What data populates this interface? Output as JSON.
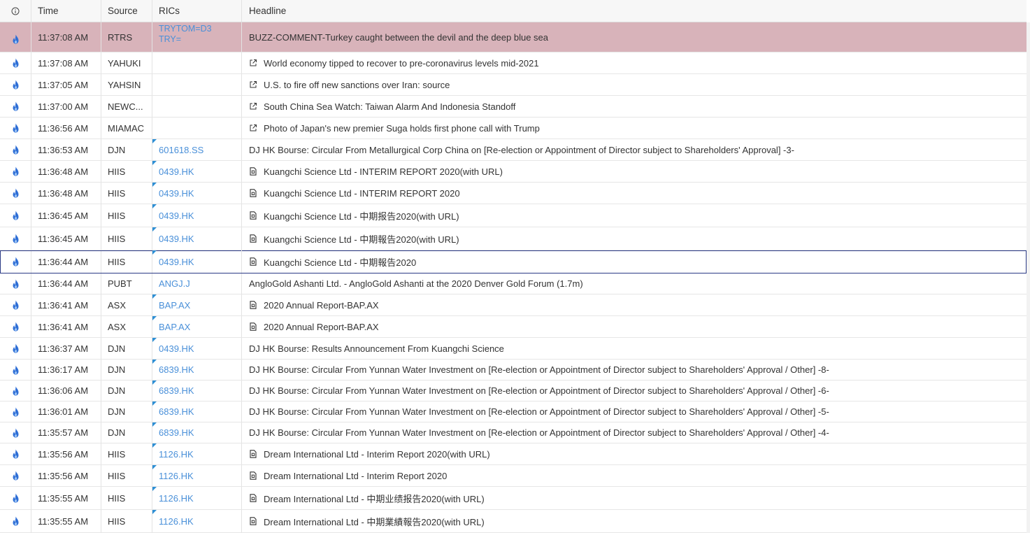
{
  "headers": {
    "info": "ⓘ",
    "time": "Time",
    "source": "Source",
    "rics": "RICs",
    "headline": "Headline"
  },
  "colors": {
    "accent": "#2d8fd5",
    "ric_link": "#4a90d9",
    "alert_row": "#d8b3ba",
    "selected_border": "#2b3a86"
  },
  "rows": [
    {
      "time": "11:37:08 AM",
      "source": "RTRS",
      "ric1": "TRYTOM=D3",
      "ric2": "TRY=",
      "headline": "BUZZ-COMMENT-Turkey caught between the devil and the deep blue sea",
      "icon": "",
      "alert": true,
      "flag": false
    },
    {
      "time": "11:37:08 AM",
      "source": "YAHUKI",
      "ric1": "",
      "ric2": "",
      "headline": "World economy tipped to recover to pre-coronavirus levels mid-2021",
      "icon": "external-link",
      "flag": false
    },
    {
      "time": "11:37:05 AM",
      "source": "YAHSIN",
      "ric1": "",
      "ric2": "",
      "headline": "U.S. to fire off new sanctions over Iran: source",
      "icon": "external-link",
      "flag": false
    },
    {
      "time": "11:37:00 AM",
      "source": "NEWC...",
      "ric1": "",
      "ric2": "",
      "headline": "South China Sea Watch: Taiwan Alarm And Indonesia Standoff",
      "icon": "external-link",
      "flag": false
    },
    {
      "time": "11:36:56 AM",
      "source": "MIAMAC",
      "ric1": "",
      "ric2": "",
      "headline": "Photo of Japan's new premier Suga holds first phone call with Trump",
      "icon": "external-link",
      "flag": false
    },
    {
      "time": "11:36:53 AM",
      "source": "DJN",
      "ric1": "601618.SS",
      "ric2": "",
      "headline": "DJ HK Bourse: Circular From Metallurgical Corp China on [Re-election or Appointment of Director subject to Shareholders' Approval] -3-",
      "icon": "",
      "flag": true
    },
    {
      "time": "11:36:48 AM",
      "source": "HIIS",
      "ric1": "0439.HK",
      "ric2": "",
      "headline": "Kuangchi Science Ltd - INTERIM REPORT 2020(with URL)",
      "icon": "document",
      "flag": true
    },
    {
      "time": "11:36:48 AM",
      "source": "HIIS",
      "ric1": "0439.HK",
      "ric2": "",
      "headline": "Kuangchi Science Ltd - INTERIM REPORT 2020",
      "icon": "document",
      "flag": true
    },
    {
      "time": "11:36:45 AM",
      "source": "HIIS",
      "ric1": "0439.HK",
      "ric2": "",
      "headline": "Kuangchi Science Ltd - 中期报告2020(with URL)",
      "icon": "document",
      "flag": true
    },
    {
      "time": "11:36:45 AM",
      "source": "HIIS",
      "ric1": "0439.HK",
      "ric2": "",
      "headline": "Kuangchi Science Ltd - 中期報告2020(with URL)",
      "icon": "document",
      "flag": true
    },
    {
      "time": "11:36:44 AM",
      "source": "HIIS",
      "ric1": "0439.HK",
      "ric2": "",
      "headline": "Kuangchi Science Ltd - 中期報告2020",
      "icon": "document",
      "flag": true,
      "selected": true
    },
    {
      "time": "11:36:44 AM",
      "source": "PUBT",
      "ric1": "ANGJ.J",
      "ric2": "",
      "headline": "AngloGold Ashanti Ltd. - AngloGold Ashanti at the 2020 Denver Gold Forum (1.7m)",
      "icon": "",
      "flag": false
    },
    {
      "time": "11:36:41 AM",
      "source": "ASX",
      "ric1": "BAP.AX",
      "ric2": "",
      "headline": "2020 Annual Report-BAP.AX",
      "icon": "document",
      "flag": true
    },
    {
      "time": "11:36:41 AM",
      "source": "ASX",
      "ric1": "BAP.AX",
      "ric2": "",
      "headline": "2020 Annual Report-BAP.AX",
      "icon": "document",
      "flag": true
    },
    {
      "time": "11:36:37 AM",
      "source": "DJN",
      "ric1": "0439.HK",
      "ric2": "",
      "headline": "DJ HK Bourse: Results Announcement From Kuangchi Science",
      "icon": "",
      "flag": true
    },
    {
      "time": "11:36:17 AM",
      "source": "DJN",
      "ric1": "6839.HK",
      "ric2": "",
      "headline": "DJ HK Bourse: Circular From Yunnan Water Investment on [Re-election or Appointment of Director subject to Shareholders' Approval / Other] -8-",
      "icon": "",
      "flag": true
    },
    {
      "time": "11:36:06 AM",
      "source": "DJN",
      "ric1": "6839.HK",
      "ric2": "",
      "headline": "DJ HK Bourse: Circular From Yunnan Water Investment on [Re-election or Appointment of Director subject to Shareholders' Approval / Other] -6-",
      "icon": "",
      "flag": true
    },
    {
      "time": "11:36:01 AM",
      "source": "DJN",
      "ric1": "6839.HK",
      "ric2": "",
      "headline": "DJ HK Bourse: Circular From Yunnan Water Investment on [Re-election or Appointment of Director subject to Shareholders' Approval / Other] -5-",
      "icon": "",
      "flag": true
    },
    {
      "time": "11:35:57 AM",
      "source": "DJN",
      "ric1": "6839.HK",
      "ric2": "",
      "headline": "DJ HK Bourse: Circular From Yunnan Water Investment on [Re-election or Appointment of Director subject to Shareholders' Approval / Other] -4-",
      "icon": "",
      "flag": true
    },
    {
      "time": "11:35:56 AM",
      "source": "HIIS",
      "ric1": "1126.HK",
      "ric2": "",
      "headline": "Dream International Ltd - Interim Report 2020(with URL)",
      "icon": "document",
      "flag": true
    },
    {
      "time": "11:35:56 AM",
      "source": "HIIS",
      "ric1": "1126.HK",
      "ric2": "",
      "headline": "Dream International Ltd - Interim Report 2020",
      "icon": "document",
      "flag": true
    },
    {
      "time": "11:35:55 AM",
      "source": "HIIS",
      "ric1": "1126.HK",
      "ric2": "",
      "headline": "Dream International Ltd - 中期业绩报告2020(with URL)",
      "icon": "document",
      "flag": true
    },
    {
      "time": "11:35:55 AM",
      "source": "HIIS",
      "ric1": "1126.HK",
      "ric2": "",
      "headline": "Dream International Ltd - 中期業績報告2020(with URL)",
      "icon": "document",
      "flag": true
    }
  ]
}
